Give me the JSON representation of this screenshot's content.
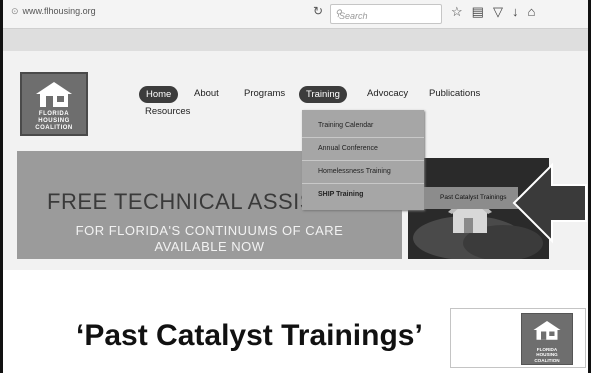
{
  "browser": {
    "url": "www.flhousing.org",
    "search_placeholder": "Search",
    "reload_icon": "reload-icon",
    "toolbar_icons": [
      "star-icon",
      "reading-list-icon",
      "pocket-icon",
      "download-icon",
      "home-icon"
    ]
  },
  "logo": {
    "line1": "FLORIDA",
    "line2": "HOUSING",
    "line3": "COALITION"
  },
  "nav": {
    "home": "Home",
    "about": "About",
    "programs": "Programs",
    "training": "Training",
    "advocacy": "Advocacy",
    "publications": "Publications",
    "resources": "Resources"
  },
  "dropdown": {
    "items": [
      "Training Calendar",
      "Annual Conference",
      "Homelessness Training",
      "SHIP Training"
    ],
    "flyout": "Past Catalyst Trainings"
  },
  "banner": {
    "line1": "FREE TECHNICAL ASSIS",
    "line2": "FOR FLORIDA'S CONTINUUMS OF CARE",
    "line3": "AVAILABLE NOW"
  },
  "caption": "‘Past Catalyst Trainings’",
  "colors": {
    "nav_active": "#3c3c3c",
    "banner_bg": "#9b9b9b",
    "dropdown_bg": "#a6a6a6",
    "arrow_fill": "#3a3a3a"
  }
}
